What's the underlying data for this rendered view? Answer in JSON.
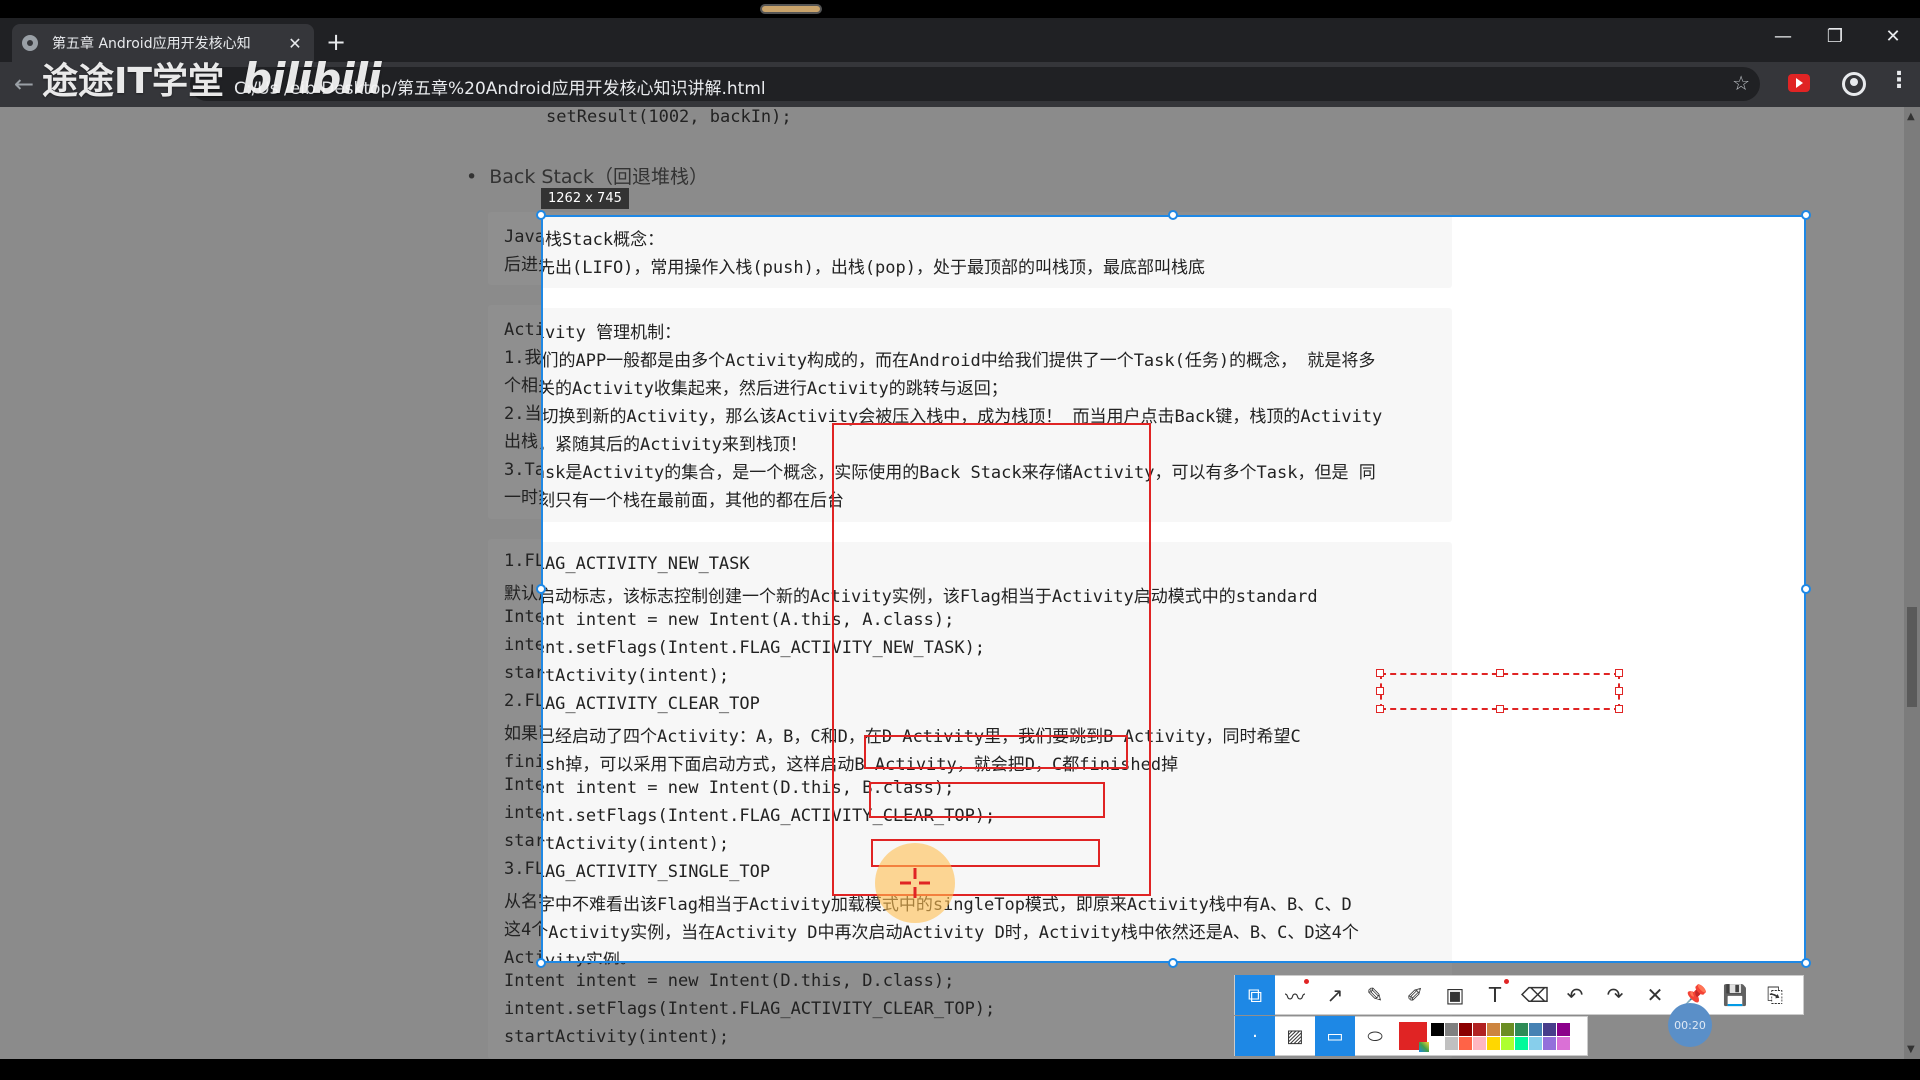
{
  "browser": {
    "tab_title": "第五章 Android应用开发核心知",
    "tab_close": "✕",
    "new_tab": "+",
    "url": "C:/Us   /eib   Desktop/第五章%20Android应用开发核心知识讲解.html",
    "window_controls": [
      "—",
      "❐",
      "✕"
    ]
  },
  "watermark": {
    "text": "途途IT学堂",
    "logo": "bilibili"
  },
  "page": {
    "code_top": "setResult(1002, backIn);",
    "bullet_heading": "Back Stack（回退堆栈）",
    "block1": {
      "lines": [
        "Java栈Stack概念：",
        "后进先出(LIFO)，常用操作入栈(push)，出栈(pop)，处于最顶部的叫栈顶，最底部叫栈底"
      ]
    },
    "block2": {
      "lines": [
        "Activity 管理机制：",
        "1.我们的APP一般都是由多个Activity构成的，而在Android中给我们提供了一个Task(任务)的概念，  就是将多",
        "个相关的Activity收集起来，然后进行Activity的跳转与返回；",
        "2.当切换到新的Activity，那么该Activity会被压入栈中，成为栈顶！  而当用户点击Back键，栈顶的Activity",
        "出栈，紧随其后的Activity来到栈顶！",
        "3.Task是Activity的集合，是一个概念，实际使用的Back Stack来存储Activity，可以有多个Task，但是 同",
        "一时刻只有一个栈在最前面，其他的都在后台"
      ]
    },
    "block3": {
      "lines": [
        "1.FLAG_ACTIVITY_NEW_TASK",
        "  默认启动标志，该标志控制创建一个新的Activity实例，该Flag相当于Activity启动模式中的standard",
        "  Intent intent = new Intent(A.this, A.class);",
        "  intent.setFlags(Intent.FLAG_ACTIVITY_NEW_TASK);",
        "  startActivity(intent);",
        "2.FLAG_ACTIVITY_CLEAR_TOP",
        "  如果已经启动了四个Activity：A，B，C和D，在D Activity里，我们要跳到B Activity，同时希望C",
        "finish掉，可以采用下面启动方式，这样启动B Activity，就会把D，C都finished掉",
        "  Intent intent = new Intent(D.this, B.class);",
        "  intent.setFlags(Intent.FLAG_ACTIVITY_CLEAR_TOP);",
        "  startActivity(intent);",
        "3.FLAG_ACTIVITY_SINGLE_TOP",
        "  从名字中不难看出该Flag相当于Activity加载模式中的singleTop模式，即原来Activity栈中有A、B、C、D",
        "这4个Activity实例，当在Activity D中再次启动Activity D时，Activity栈中依然还是A、B、C、D这4个",
        "Activity实例。",
        "  Intent intent = new Intent(D.this, D.class);",
        "  intent.setFlags(Intent.FLAG_ACTIVITY_CLEAR_TOP);",
        "  startActivity(intent);"
      ]
    }
  },
  "selection": {
    "size_label": "1262 x 745"
  },
  "annotation_toolbar": {
    "tools": [
      "select-icon",
      "polyline-icon",
      "arrow-icon",
      "pencil-icon",
      "marker-icon",
      "mosaic-icon",
      "text-icon",
      "eraser-icon",
      "undo-icon",
      "redo-icon",
      "close-icon",
      "pin-icon",
      "save-icon",
      "copy-icon"
    ],
    "tool_glyphs": [
      "⧉",
      "〰",
      "↗",
      "✎",
      "✐",
      "▣",
      "T",
      "⌫",
      "↶",
      "↷",
      "✕",
      "📌",
      "💾",
      "⎘"
    ],
    "shape_glyphs": [
      "·",
      "▨",
      "▭",
      "⬭"
    ],
    "accent": "#1e88e5",
    "current_color": "#e02424",
    "palette": [
      "#000000",
      "#808080",
      "#8b0000",
      "#b22222",
      "#cd853f",
      "#6b8e23",
      "#2e8b57",
      "#4682b4",
      "#483d8b",
      "#8b008b",
      "#ffffff",
      "#c0c0c0",
      "#ff6347",
      "#ffb6c1",
      "#ffd700",
      "#adff2f",
      "#00fa9a",
      "#87ceeb",
      "#9370db",
      "#da70d6"
    ]
  },
  "recording_timer": "00:20"
}
